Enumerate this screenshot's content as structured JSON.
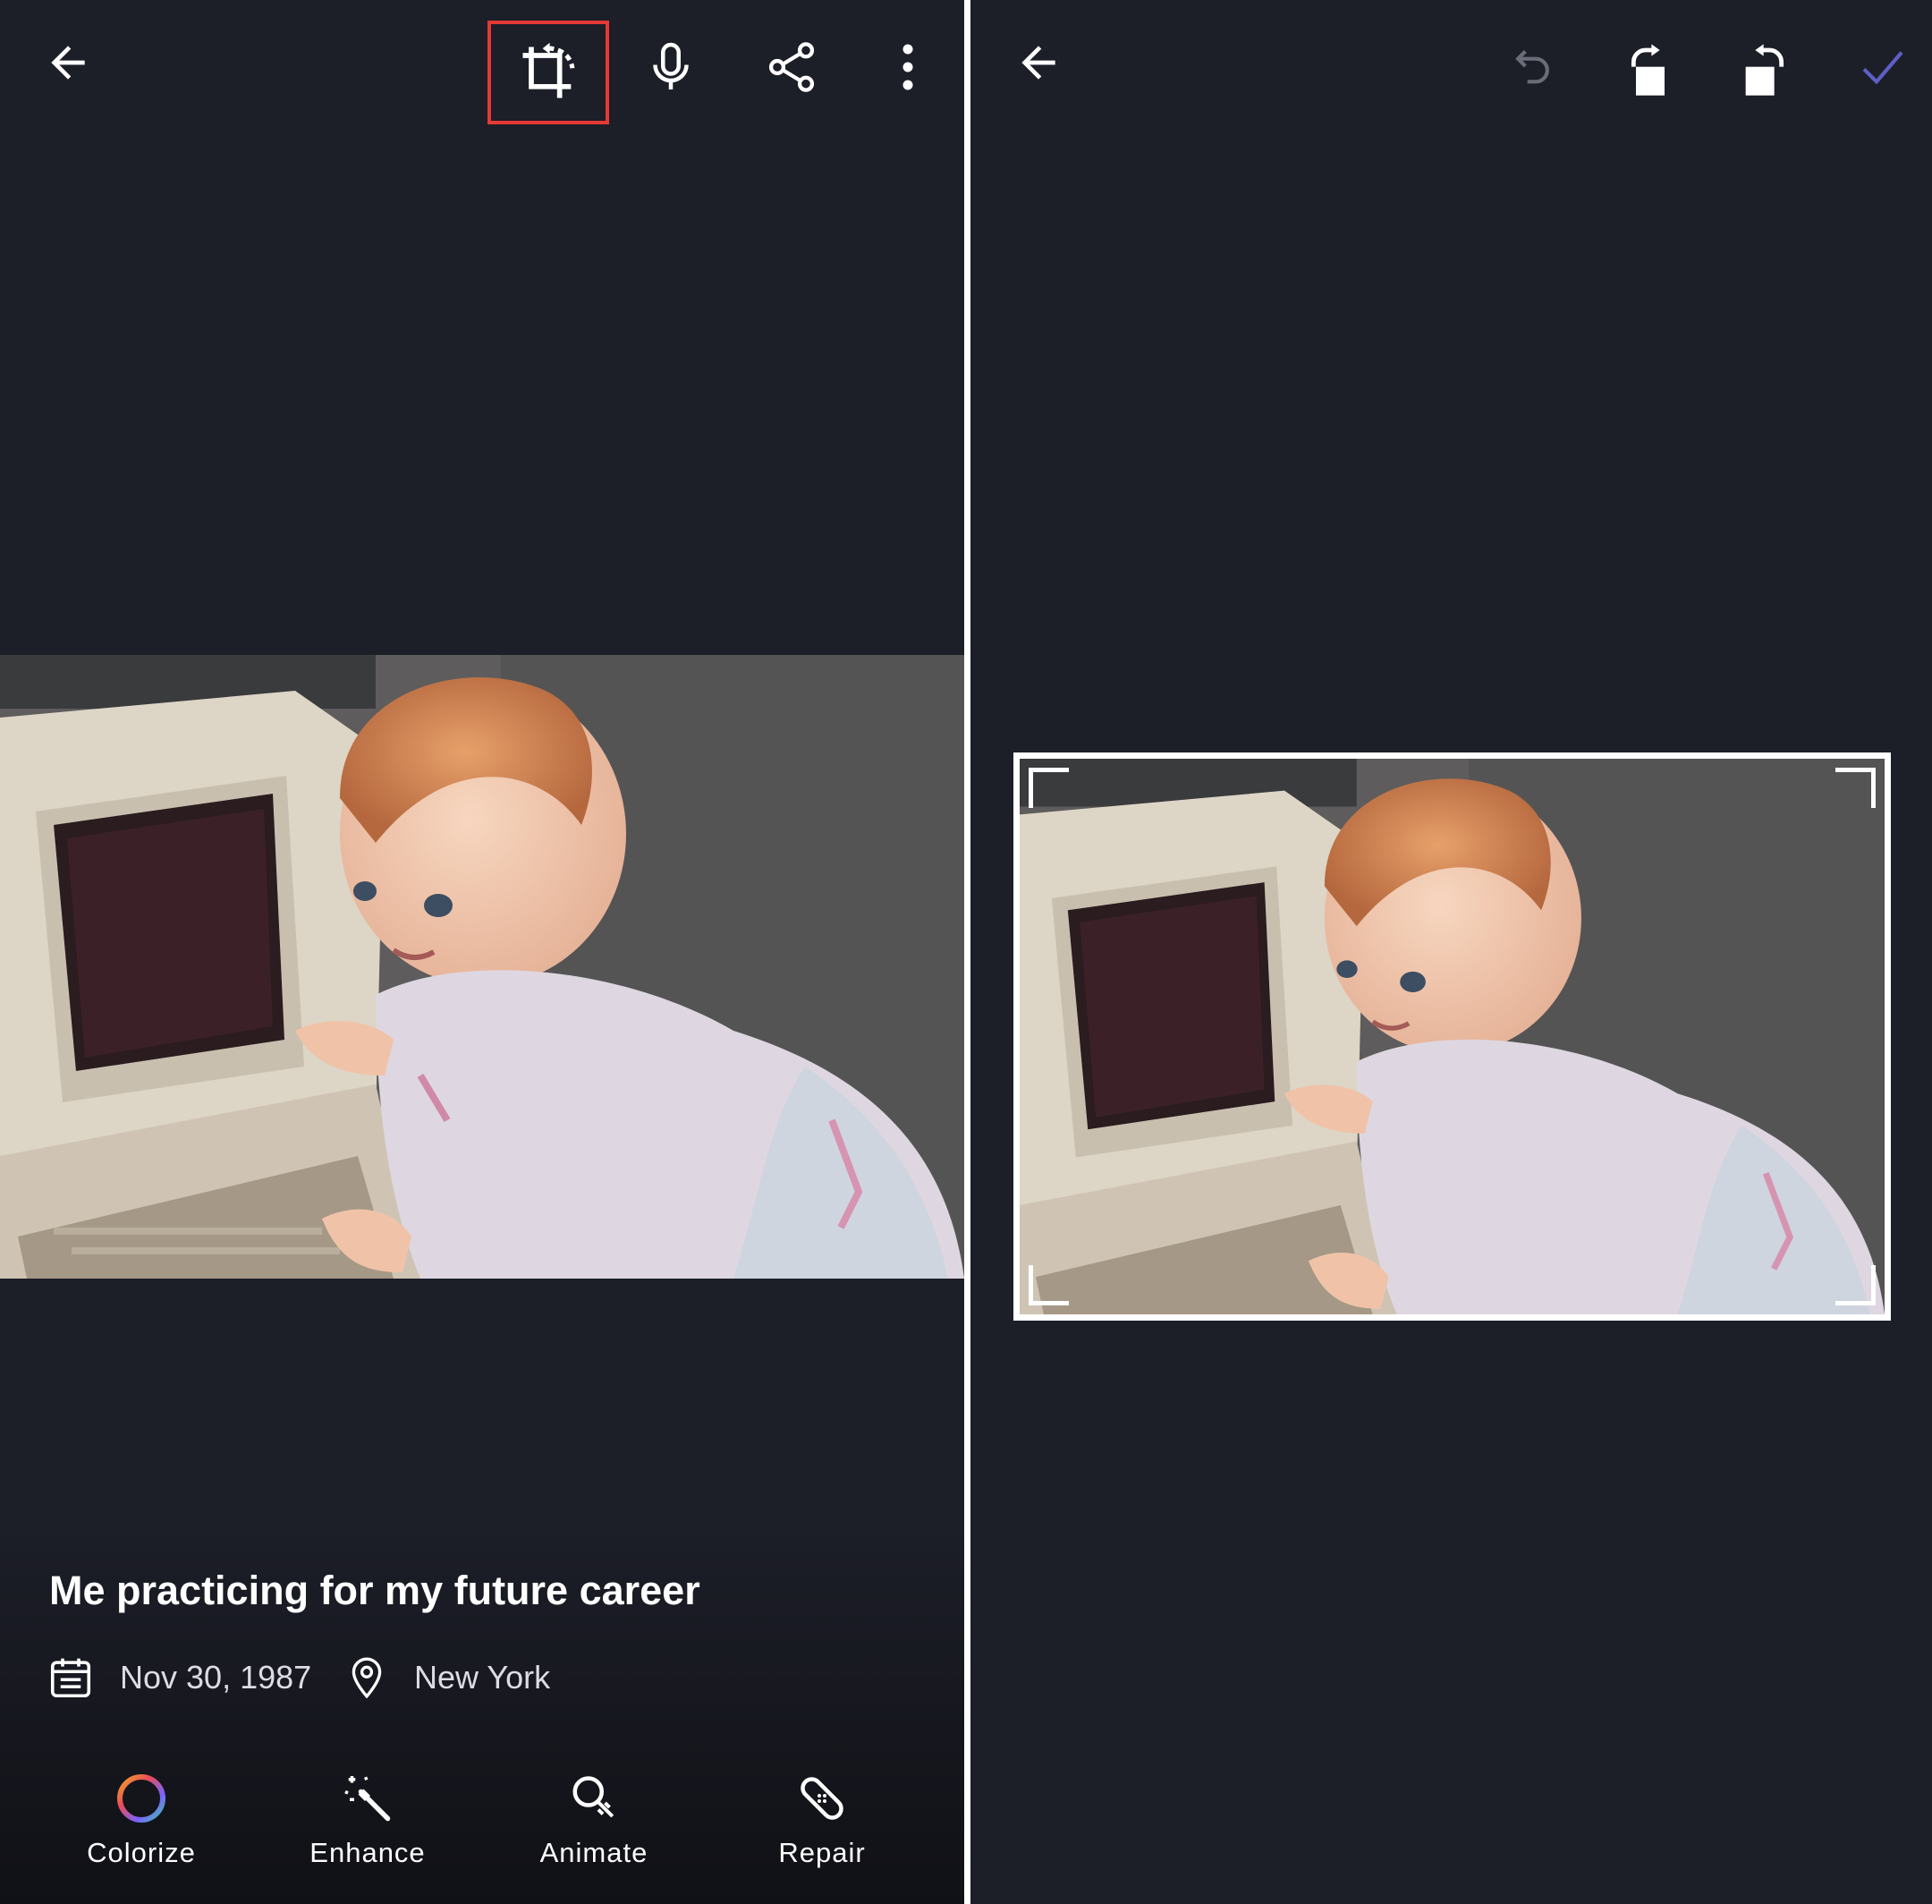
{
  "left_pane": {
    "toolbar": {
      "back_icon": "arrow-back-icon",
      "crop_rotate_icon": "crop-rotate-icon",
      "highlight_color": "#e53935",
      "mic_icon": "microphone-icon",
      "share_icon": "share-icon",
      "more_icon": "more-vertical-icon"
    },
    "photo": {
      "title": "Me practicing for my future career",
      "date": "Nov 30, 1987",
      "location": "New York"
    },
    "actions": [
      {
        "label": "Colorize",
        "icon": "colorize-ring-icon"
      },
      {
        "label": "Enhance",
        "icon": "magic-wand-icon"
      },
      {
        "label": "Animate",
        "icon": "animate-icon"
      },
      {
        "label": "Repair",
        "icon": "bandage-icon"
      }
    ]
  },
  "right_pane": {
    "toolbar": {
      "back_icon": "arrow-back-icon",
      "undo_icon": "undo-icon",
      "rotate_right_icon": "rotate-right-icon",
      "rotate_left_icon": "rotate-left-icon",
      "confirm_icon": "checkmark-icon",
      "confirm_color": "#5c5fc4"
    }
  },
  "colors": {
    "background": "#1c1e28",
    "divider": "#ffffff",
    "text_secondary": "#dcdde3"
  }
}
